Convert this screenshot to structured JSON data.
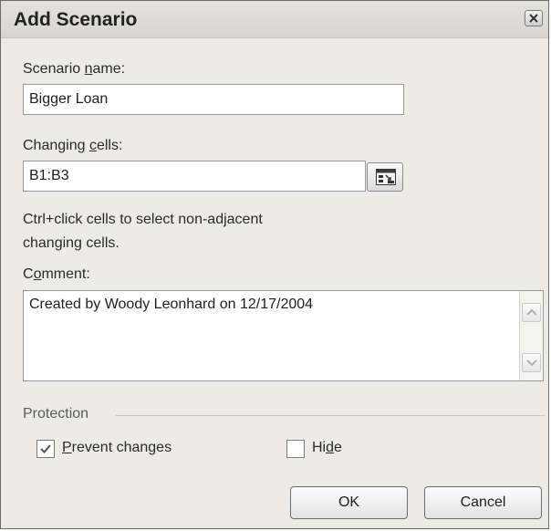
{
  "dialog": {
    "title": "Add Scenario",
    "scenario_name": {
      "label_pre": "Scenario ",
      "label_key": "n",
      "label_post": "ame:",
      "value": "Bigger Loan"
    },
    "changing_cells": {
      "label_pre": "Changing ",
      "label_key": "c",
      "label_post": "ells:",
      "value": "B1:B3"
    },
    "hint_line1": "Ctrl+click cells to select non-adjacent",
    "hint_line2": "changing cells.",
    "comment": {
      "label_pre": "C",
      "label_key": "o",
      "label_post": "mment:",
      "value": "Created by Woody Leonhard on 12/17/2004"
    },
    "protection": {
      "label": "Protection",
      "prevent_changes": {
        "label_key": "P",
        "label_post": "revent changes",
        "checked": true
      },
      "hide": {
        "label_pre": "Hi",
        "label_key": "d",
        "label_post": "e",
        "checked": false
      }
    },
    "ok_label": "OK",
    "cancel_label": "Cancel"
  }
}
